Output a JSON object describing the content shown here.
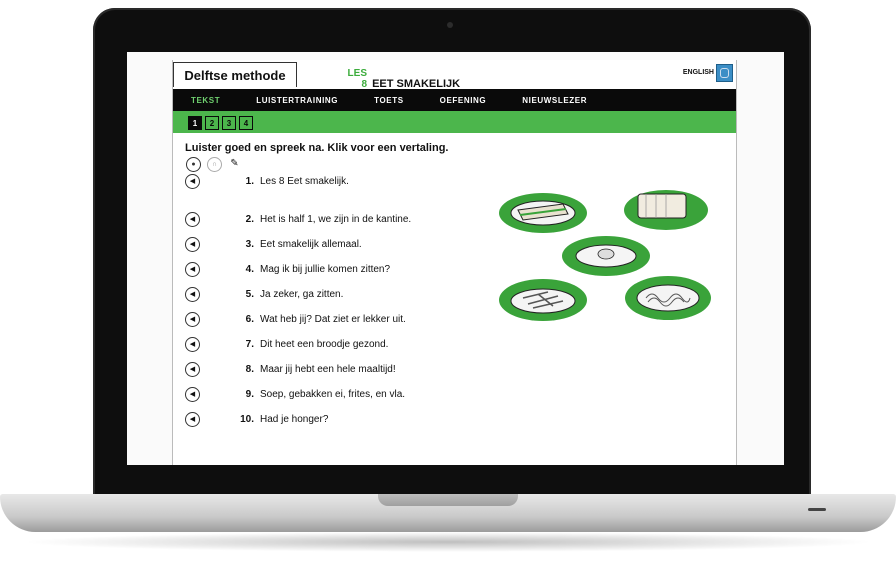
{
  "app": {
    "brand": "Delftse methode",
    "lesson_num": "LES 8",
    "lesson_title": "EET SMAKELIJK",
    "language_link": "ENGLISH"
  },
  "nav": [
    "TEKST",
    "LUISTERTRAINING",
    "TOETS",
    "OEFENING",
    "NIEUWSLEZER"
  ],
  "pages": [
    "1",
    "2",
    "3",
    "4"
  ],
  "instruction": "Luister goed en spreek na. Klik voor een vertaling.",
  "lines": [
    {
      "n": "1.",
      "t": "Les 8 Eet smakelijk."
    },
    {
      "n": "2.",
      "t": "Het is half 1, we zijn in de kantine."
    },
    {
      "n": "3.",
      "t": "Eet smakelijk allemaal."
    },
    {
      "n": "4.",
      "t": "Mag ik bij jullie komen zitten?"
    },
    {
      "n": "5.",
      "t": "Ja zeker, ga zitten."
    },
    {
      "n": "6.",
      "t": "Wat heb jij? Dat ziet er lekker uit."
    },
    {
      "n": "7.",
      "t": "Dit heet een broodje gezond."
    },
    {
      "n": "8.",
      "t": "Maar jij hebt een hele maaltijd!"
    },
    {
      "n": "9.",
      "t": "Soep, gebakken ei, frites, en vla."
    },
    {
      "n": "10.",
      "t": "Had je honger?"
    }
  ],
  "icons": {
    "record": "microphone-icon",
    "listen": "headphones-icon",
    "settings": "wrench-icon",
    "speaker": "speaker-icon"
  },
  "colors": {
    "accent_green": "#4cb64c",
    "nav_bg": "#0a0a0a",
    "nav_active": "#6fd06f"
  }
}
